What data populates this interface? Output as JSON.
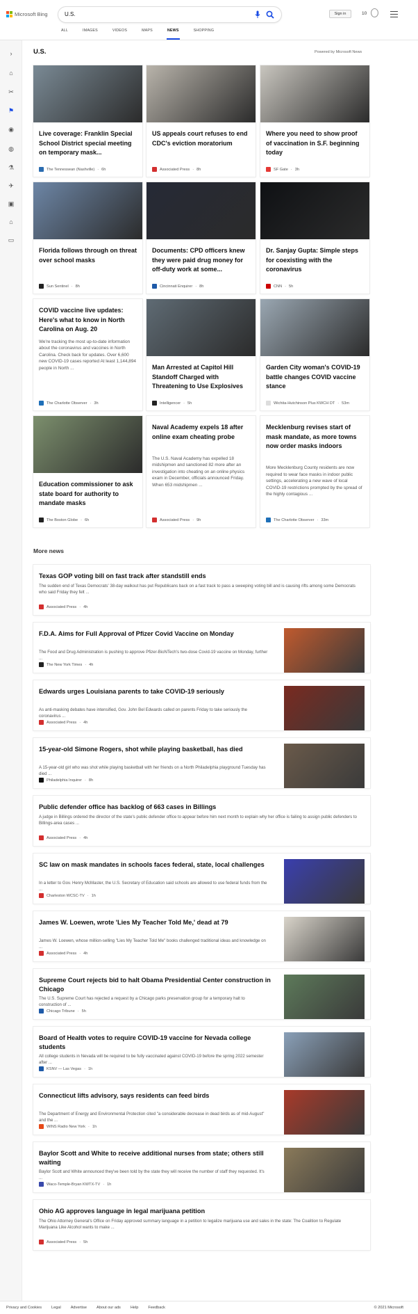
{
  "brand": {
    "name": "Microsoft Bing"
  },
  "search": {
    "query": "U.S."
  },
  "header": {
    "signin_label": "Sign in",
    "points": "10"
  },
  "tabs": [
    {
      "label": "ALL",
      "active": false
    },
    {
      "label": "IMAGES",
      "active": false
    },
    {
      "label": "VIDEOS",
      "active": false
    },
    {
      "label": "MAPS",
      "active": false
    },
    {
      "label": "NEWS",
      "active": true
    },
    {
      "label": "SHOPPING",
      "active": false
    }
  ],
  "rail_icons": [
    "chevron-right-icon",
    "home-icon",
    "tools-icon",
    "flag-icon",
    "map-pin-icon",
    "globe-icon",
    "microscope-icon",
    "rocket-icon",
    "film-icon",
    "bank-icon",
    "card-icon"
  ],
  "section": {
    "title": "U.S.",
    "powered_by": "Powered by Microsoft News"
  },
  "cards": [
    {
      "title": "Live coverage: Franklin Special School District special meeting on temporary mask...",
      "snippet": "",
      "source": "The Tennessean (Nashville)",
      "time": "6h",
      "img": "#7a8a95",
      "src_color": "#2b6cb0"
    },
    {
      "title": "US appeals court refuses to end CDC's eviction moratorium",
      "snippet": "",
      "source": "Associated Press",
      "time": "8h",
      "img": "#b9b4ab",
      "src_color": "#d32f2f"
    },
    {
      "title": "Where you need to show proof of vaccination in S.F. beginning today",
      "snippet": "",
      "source": "SF Gate",
      "time": "3h",
      "img": "#c9c6bf",
      "src_color": "#e53935"
    },
    {
      "title": "Florida follows through on threat over school masks",
      "snippet": "",
      "source": "Sun Sentinel",
      "time": "8h",
      "img": "#6d86a6",
      "src_color": "#222222"
    },
    {
      "title": "Documents: CPD officers knew they were paid drug money for off-duty work at some...",
      "snippet": "",
      "source": "Cincinnati Enquirer",
      "time": "8h",
      "img": "#262a36",
      "src_color": "#1e5aa8"
    },
    {
      "title": "Dr. Sanjay Gupta: Simple steps for coexisting with the coronavirus",
      "snippet": "",
      "source": "CNN",
      "time": "5h",
      "img": "#0f1114",
      "src_color": "#cc0000"
    },
    {
      "title": "COVID vaccine live updates: Here's what to know in North Carolina on Aug. 20",
      "snippet": "We're tracking the most up-to-date information about the coronavirus and vaccines in North Carolina. Check back for updates. Over 6,600 new COVID-19 cases reported At least 1,144,894 people in North ...",
      "source": "The Charlotte Observer",
      "time": "3h",
      "img": "",
      "src_color": "#1e6fb8"
    },
    {
      "title": "Man Arrested at Capitol Hill Standoff Charged with Threatening to Use Explosives",
      "snippet": "",
      "source": "Intelligencer",
      "time": "5h",
      "img": "#5f6b74",
      "src_color": "#222222"
    },
    {
      "title": "Garden City woman's COVID-19 battle changes COVID vaccine stance",
      "snippet": "",
      "source": "Wichita-Hutchinson Plus KWCH DT",
      "time": "53m",
      "img": "#9aa7b2",
      "src_color": "#dddddd"
    },
    {
      "title": "Education commissioner to ask state board for authority to mandate masks",
      "snippet": "",
      "source": "The Boston Globe",
      "time": "6h",
      "img": "#7c8f6d",
      "src_color": "#222222"
    },
    {
      "title": "Naval Academy expels 18 after online exam cheating probe",
      "snippet": "The U.S. Naval Academy has expelled 18 midshipmen and sanctioned 82 more after an investigation into cheating on an online physics exam in December, officials announced Friday. When 653 midshipmen ...",
      "source": "Associated Press",
      "time": "9h",
      "img": "",
      "src_color": "#d32f2f"
    },
    {
      "title": "Mecklenburg revises start of mask mandate, as more towns now order masks indoors",
      "snippet": "More Mecklenburg County residents are now required to wear face masks in indoor public settings, accelerating a new wave of local COVID-19 restrictions prompted by the spread of the highly contagious ...",
      "source": "The Charlotte Observer",
      "time": "33m",
      "img": "",
      "src_color": "#1e6fb8"
    }
  ],
  "more_news": {
    "title": "More news",
    "items": [
      {
        "title": "Texas GOP voting bill on fast track after standstill ends",
        "snippet": "The sudden end of Texas Democrats' 38-day walkout has put Republicans back on a fast track to pass a sweeping voting bill and is causing rifts among some Democrats who said Friday they felt ...",
        "source": "Associated Press",
        "time": "4h",
        "thumb": "",
        "src_color": "#d32f2f"
      },
      {
        "title": "F.D.A. Aims for Full Approval of Pfizer Covid Vaccine on Monday",
        "snippet": "The Food and Drug Administration is pushing to approve Pfizer-BioNTech's two-dose Covid-19 vaccine on Monday, further ...",
        "source": "The New York Times",
        "time": "4h",
        "thumb": "#c05a2e",
        "src_color": "#222222"
      },
      {
        "title": "Edwards urges Louisiana parents to take COVID-19 seriously",
        "snippet": "As anti-masking debates have intensified, Gov. John Bel Edwards called on parents Friday to take seriously the coronavirus ...",
        "source": "Associated Press",
        "time": "4h",
        "thumb": "#7a2a20",
        "src_color": "#d32f2f"
      },
      {
        "title": "15-year-old Simone Rogers, shot while playing basketball, has died",
        "snippet": "A 15-year-old girl who was shot while playing basketball with her friends on a North Philadelphia playground Tuesday has died ...",
        "source": "Philadelphia Inquirer",
        "time": "8h",
        "thumb": "#6a5a4a",
        "src_color": "#111111"
      },
      {
        "title": "Public defender office has backlog of 663 cases in Billings",
        "snippet": "A judge in Billings ordered the director of the state's public defender office to appear before him next month to explain why her office is failing to assign public defenders to Billings-area cases ...",
        "source": "Associated Press",
        "time": "4h",
        "thumb": "",
        "src_color": "#d32f2f"
      },
      {
        "title": "SC law on mask mandates in schools faces federal, state, local challenges",
        "snippet": "In a letter to Gov. Henry McMaster, the U.S. Secretary of Education said schools are allowed to use federal funds from the ...",
        "source": "Charleston WCSC-TV",
        "time": "1h",
        "thumb": "#3a3fae",
        "src_color": "#d32f2f"
      },
      {
        "title": "James W. Loewen, wrote 'Lies My Teacher Told Me,' dead at 79",
        "snippet": "James W. Loewen, whose million-selling \"Lies My Teacher Told Me\" books challenged traditional ideas and knowledge on ...",
        "source": "Associated Press",
        "time": "4h",
        "thumb": "#d9d4ca",
        "src_color": "#d32f2f"
      },
      {
        "title": "Supreme Court rejects bid to halt Obama Presidential Center construction in Chicago",
        "snippet": "The U.S. Supreme Court has rejected a request by a Chicago parks preservation group for a temporary halt to construction of ...",
        "source": "Chicago Tribune",
        "time": "5h",
        "thumb": "#5d7a5a",
        "src_color": "#1e5aa8"
      },
      {
        "title": "Board of Health votes to require COVID-19 vaccine for Nevada college students",
        "snippet": "All college students in Nevada will be required to be fully vaccinated against COVID-19 before the spring 2022 semester after ...",
        "source": "KSNV — Las Vegas",
        "time": "1h",
        "thumb": "#8aa0b8",
        "src_color": "#1e5aa8"
      },
      {
        "title": "Connecticut lifts advisory, says residents can feed birds",
        "snippet": "The Department of Energy and Environmental Protection cited \"a considerable decrease in dead birds as of mid-August\" and the ...",
        "source": "WINS Radio New York",
        "time": "1h",
        "thumb": "#a83a2a",
        "src_color": "#e64a19"
      },
      {
        "title": "Baylor Scott and White to receive additional nurses from state; others still waiting",
        "snippet": "Baylor Scott and White announced they've been told by the state they will receive the number of staff they requested. It's ...",
        "source": "Waco-Temple-Bryan KWTX-TV",
        "time": "1h",
        "thumb": "#8a7a5a",
        "src_color": "#3949ab"
      },
      {
        "title": "Ohio AG approves language in legal marijuana petition",
        "snippet": "The Ohio Attorney General's Office on Friday approved summary language in a petition to legalize marijuana use and sales in the state: The Coalition to Regulate Marijuana Like Alcohol wants to make ...",
        "source": "Associated Press",
        "time": "5h",
        "thumb": "",
        "src_color": "#d32f2f"
      }
    ]
  },
  "footer": {
    "links": [
      "Privacy and Cookies",
      "Legal",
      "Advertise",
      "About our ads",
      "Help",
      "Feedback"
    ],
    "copyright": "© 2021 Microsoft"
  }
}
